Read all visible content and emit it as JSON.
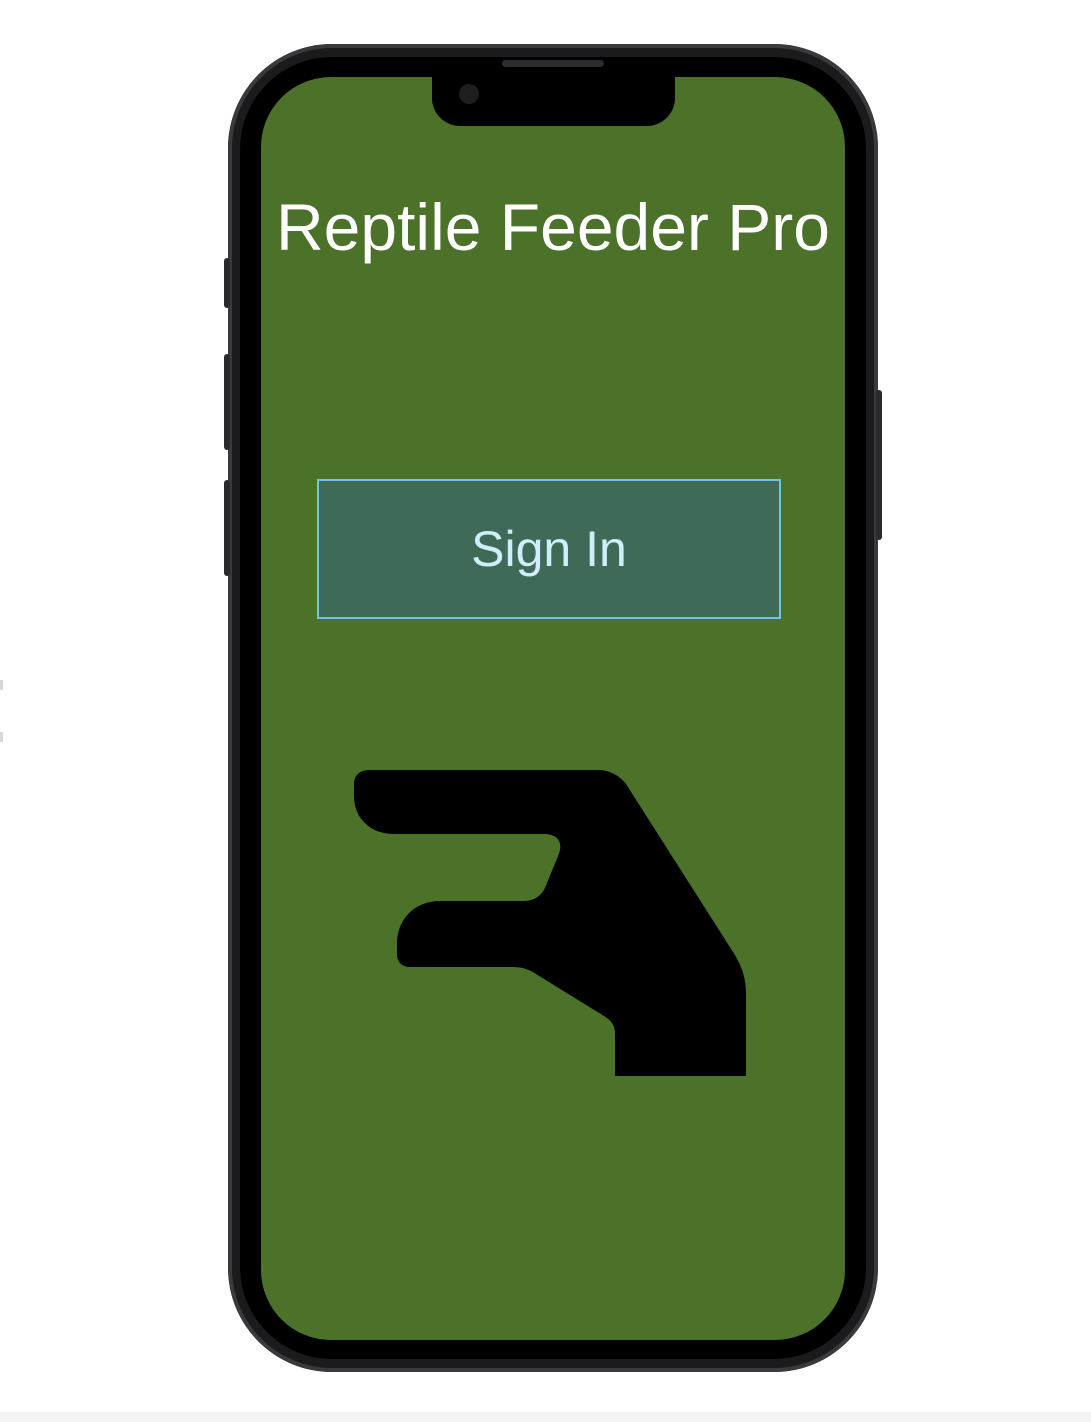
{
  "app": {
    "title": "Reptile Feeder Pro"
  },
  "actions": {
    "sign_in_label": "Sign In"
  },
  "illustration": {
    "icon": "hand-icon"
  },
  "colors": {
    "screen_background": "#4c722a",
    "button_background": "#406a58",
    "button_border": "#6fc3e3",
    "button_text": "#cfeef9",
    "title_text": "#ffffff"
  }
}
